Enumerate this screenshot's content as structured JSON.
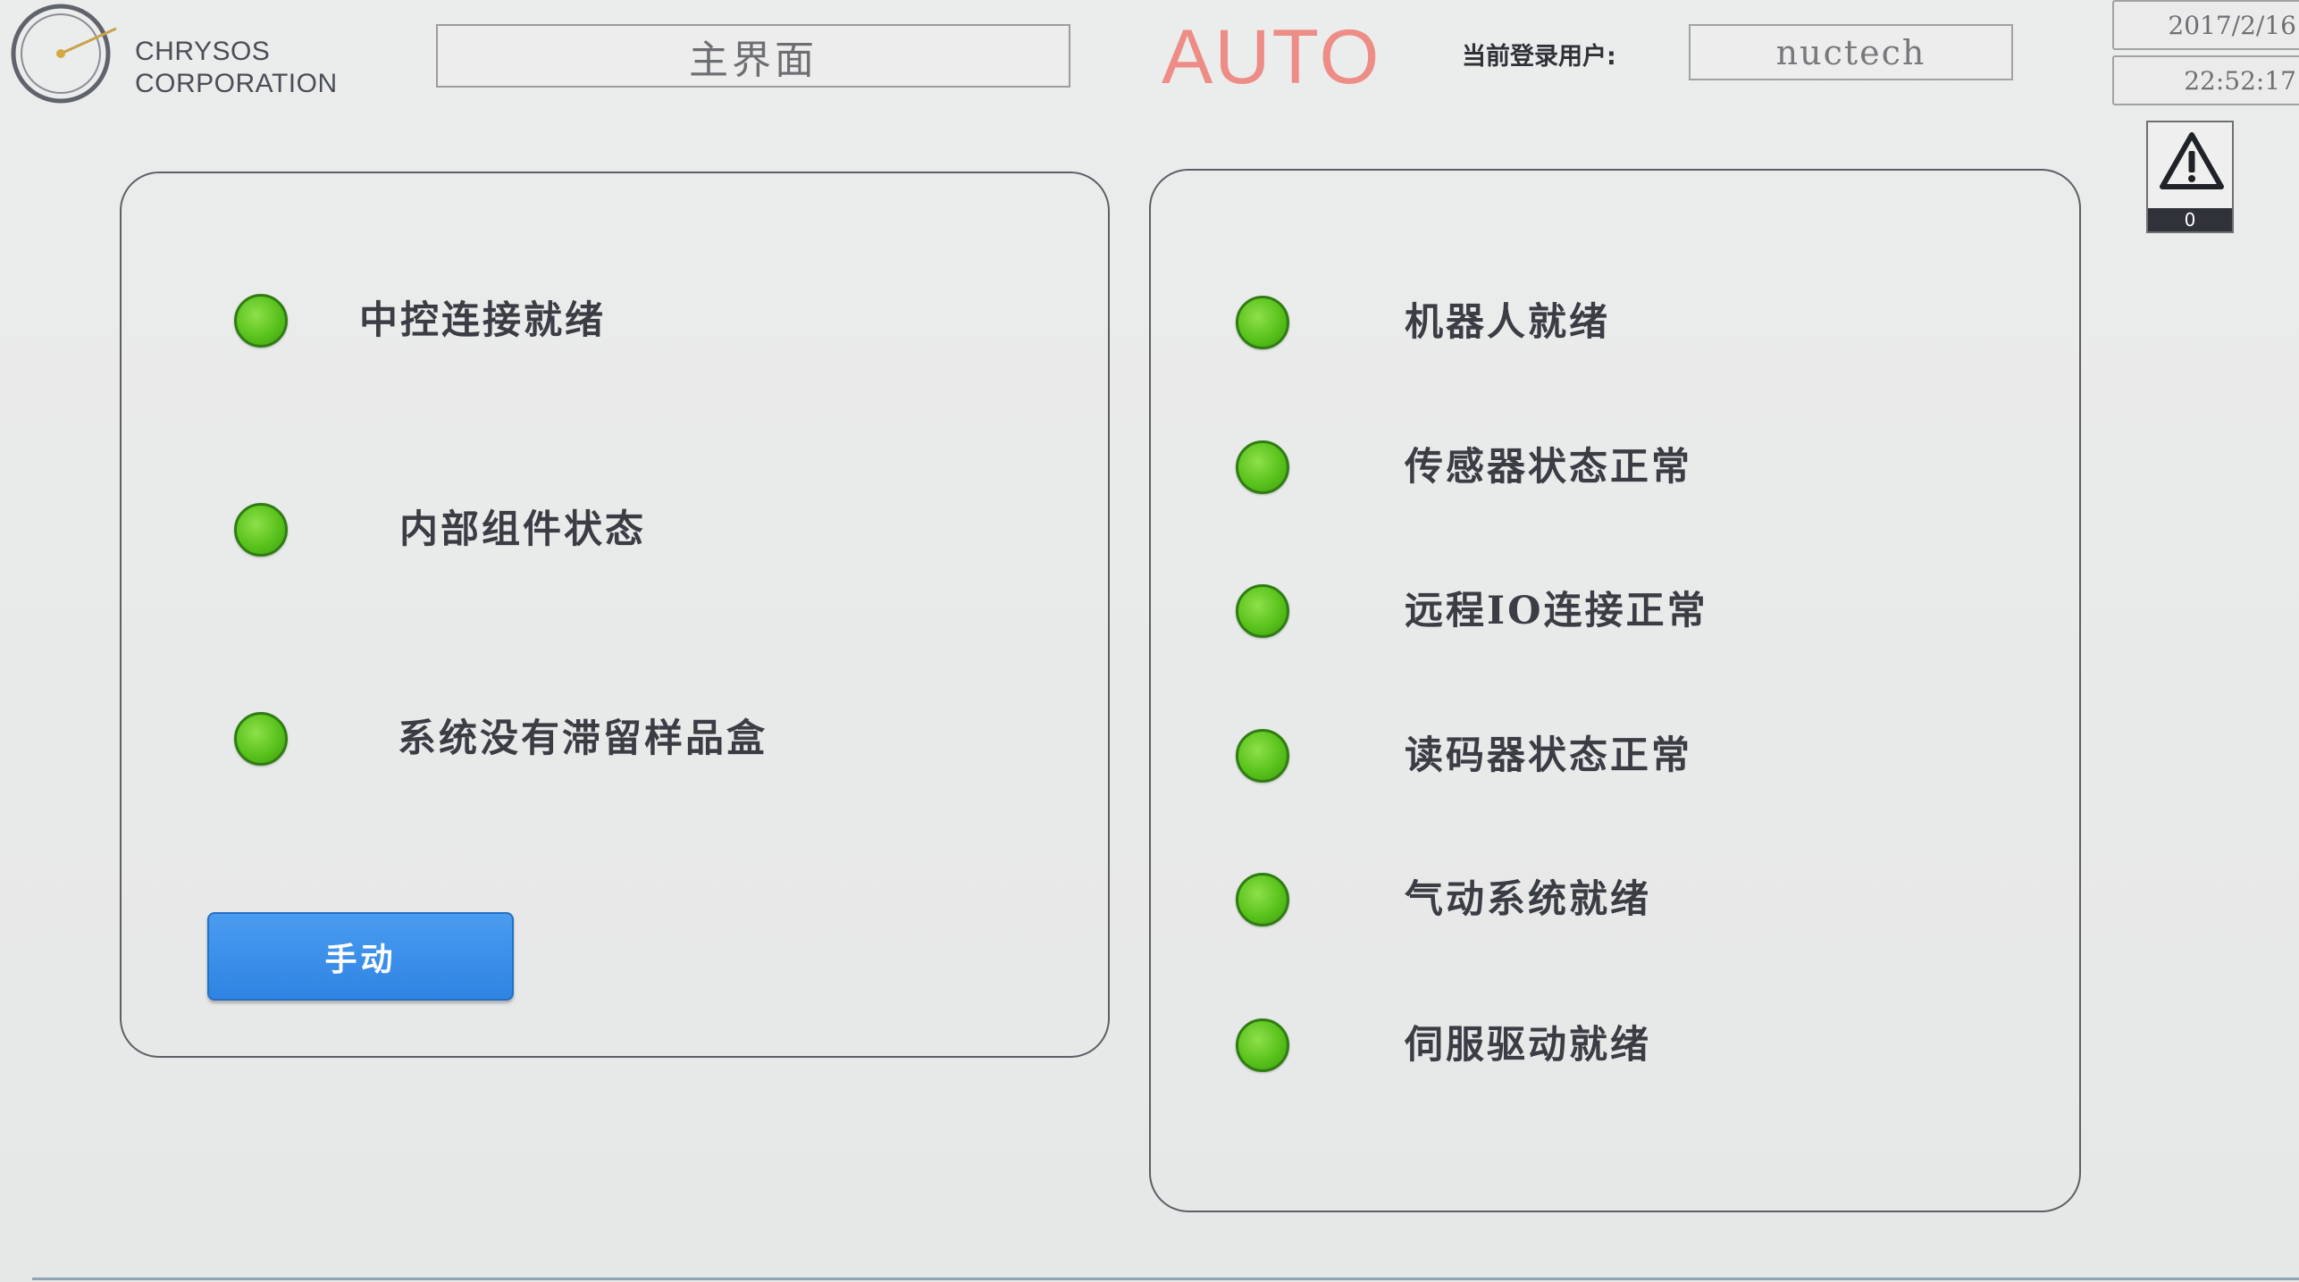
{
  "header": {
    "logo_line1": "CHRYSOS",
    "logo_line2": "CORPORATION",
    "screen_title": "主界面",
    "mode": "AUTO",
    "user_label": "当前登录用户:",
    "user_name": "nuctech",
    "date": "2017/2/16",
    "time": "22:52:17"
  },
  "alarm": {
    "icon": "warning-triangle-icon",
    "count": "0"
  },
  "left_panel": {
    "items": [
      {
        "label": "中控连接就绪",
        "status": "ok"
      },
      {
        "label": "内部组件状态",
        "status": "ok"
      },
      {
        "label": "系统没有滞留样品盒",
        "status": "ok"
      }
    ],
    "manual_button": "手动"
  },
  "right_panel": {
    "items": [
      {
        "label": "机器人就绪",
        "status": "ok"
      },
      {
        "label": "传感器状态正常",
        "status": "ok"
      },
      {
        "label": "远程IO连接正常",
        "status": "ok"
      },
      {
        "label": "读码器状态正常",
        "status": "ok"
      },
      {
        "label": "气动系统就绪",
        "status": "ok"
      },
      {
        "label": "伺服驱动就绪",
        "status": "ok"
      }
    ]
  },
  "colors": {
    "status_ok": "#59c21c",
    "mode_text": "#ee8d87",
    "button_blue": "#2f84e3"
  }
}
